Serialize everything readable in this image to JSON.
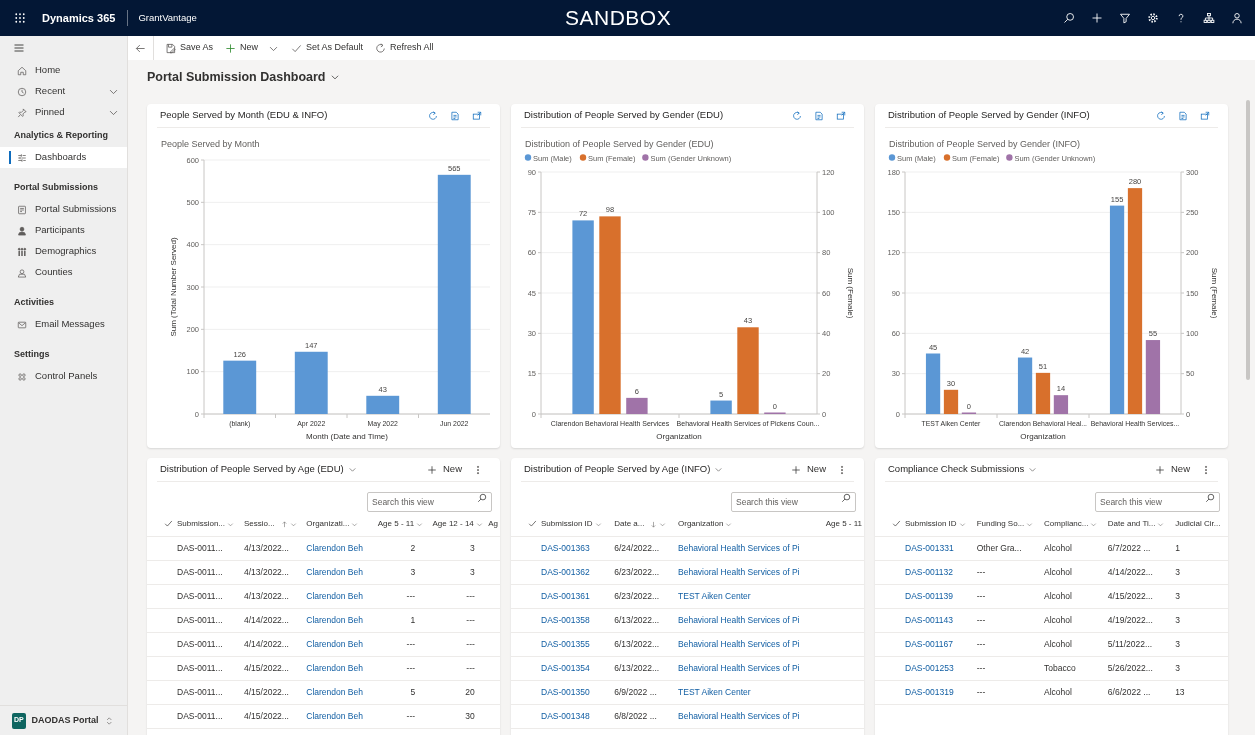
{
  "top_bar": {
    "app_name": "Dynamics 365",
    "app_module": "GrantVantage",
    "environment": "SANDBOX"
  },
  "command_bar": {
    "buttons": [
      {
        "label": "Save As",
        "dropdown": false
      },
      {
        "label": "New",
        "dropdown": true
      },
      {
        "label": "Set As Default",
        "dropdown": false
      },
      {
        "label": "Refresh All",
        "dropdown": false
      }
    ]
  },
  "sidebar": {
    "nav": [
      {
        "label": "Home",
        "expandable": false
      },
      {
        "label": "Recent",
        "expandable": true
      },
      {
        "label": "Pinned",
        "expandable": true
      }
    ],
    "groups": [
      {
        "title": "Analytics & Reporting",
        "items": [
          {
            "label": "Dashboards",
            "selected": true
          }
        ]
      },
      {
        "title": "Portal Submissions",
        "items": [
          {
            "label": "Portal Submissions",
            "selected": false
          },
          {
            "label": "Participants",
            "selected": false
          },
          {
            "label": "Demographics",
            "selected": false
          },
          {
            "label": "Counties",
            "selected": false
          }
        ]
      },
      {
        "title": "Activities",
        "items": [
          {
            "label": "Email Messages",
            "selected": false
          }
        ]
      },
      {
        "title": "Settings",
        "items": [
          {
            "label": "Control Panels",
            "selected": false
          }
        ]
      }
    ],
    "footer": {
      "badge": "DP",
      "label": "DAODAS Portal"
    }
  },
  "dashboard": {
    "title": "Portal Submission Dashboard",
    "charts": [
      {
        "title": "People Served by Month (EDU & INFO)",
        "chart_data": {
          "type": "bar",
          "title": "People Served by Month",
          "xlabel": "Month (Date and Time)",
          "ylabel": "Sum (Total Number Served)",
          "categories": [
            "(blank)",
            "Apr 2022",
            "May 2022",
            "Jun 2022"
          ],
          "values": [
            126,
            147,
            43,
            565
          ],
          "ylim": [
            0,
            600
          ],
          "yticks": [
            0,
            100,
            200,
            300,
            400,
            500,
            600
          ],
          "grid": true,
          "data_labels": true
        }
      },
      {
        "title": "Distribution of People Served by Gender (EDU)",
        "chart_data": {
          "type": "bar",
          "title": "Distribution of People Served by Gender (EDU)",
          "xlabel": "Organization",
          "y2label": "Sum (Female)",
          "categories": [
            "Clarendon Behavioral Health Services",
            "Behavioral Health Services of Pickens Coun..."
          ],
          "series": [
            {
              "name": "Sum (Male)",
              "color": "#5b97d5",
              "values": [
                72,
                5
              ]
            },
            {
              "name": "Sum (Female)",
              "color": "#d8702c",
              "axis": "y2",
              "values": [
                98,
                43
              ]
            },
            {
              "name": "Sum (Gender Unknown)",
              "color": "#a073a8",
              "values": [
                6,
                0
              ]
            }
          ],
          "legend": "top",
          "ylim": [
            0,
            90
          ],
          "yticks": [
            0,
            15,
            30,
            45,
            60,
            75,
            90
          ],
          "y2lim": [
            0,
            120
          ],
          "y2ticks": [
            0,
            20,
            40,
            60,
            80,
            100,
            120
          ],
          "grid": true,
          "data_labels": true
        }
      },
      {
        "title": "Distribution of People Served by Gender (INFO)",
        "chart_data": {
          "type": "bar",
          "title": "Distribution of People Served by Gender (INFO)",
          "xlabel": "Organization",
          "y2label": "Sum (Female)",
          "categories": [
            "TEST Aiken Center",
            "Clarendon Behavioral Heal...",
            "Behavioral Health Services..."
          ],
          "series": [
            {
              "name": "Sum (Male)",
              "color": "#5b97d5",
              "values": [
                45,
                42,
                155
              ]
            },
            {
              "name": "Sum (Female)",
              "color": "#d8702c",
              "axis": "y2",
              "values": [
                30,
                51,
                280
              ]
            },
            {
              "name": "Sum (Gender Unknown)",
              "color": "#a073a8",
              "values": [
                0,
                14,
                55
              ]
            }
          ],
          "legend": "top",
          "ylim": [
            0,
            180
          ],
          "yticks": [
            0,
            30,
            60,
            90,
            120,
            150,
            180
          ],
          "y2lim": [
            0,
            300
          ],
          "y2ticks": [
            0,
            50,
            100,
            150,
            200,
            250,
            300
          ],
          "grid": true,
          "data_labels": true
        }
      }
    ],
    "views": [
      {
        "title": "Distribution of People Served by Age (EDU)",
        "new_label": "New",
        "search_placeholder": "Search this view",
        "columns": [
          {
            "label": "Submission...",
            "kind": "text",
            "sorted": false,
            "menu": true
          },
          {
            "label": "Sessio...",
            "kind": "text",
            "sorted": true,
            "ascending": true,
            "menu": true
          },
          {
            "label": "Organizati...",
            "kind": "link",
            "sorted": false,
            "menu": true
          },
          {
            "label": "Age 5 - 11",
            "kind": "number",
            "sorted": false,
            "menu": true
          },
          {
            "label": "Age 12 - 14",
            "kind": "number",
            "sorted": false,
            "menu": true
          },
          {
            "label": "Ag",
            "kind": "number",
            "sorted": false,
            "menu": false
          }
        ],
        "rows": [
          [
            "DAS-0011...",
            "4/13/2022...",
            "Clarendon Beh",
            "2",
            "3"
          ],
          [
            "DAS-0011...",
            "4/13/2022...",
            "Clarendon Beh",
            "3",
            "3"
          ],
          [
            "DAS-0011...",
            "4/13/2022...",
            "Clarendon Beh",
            "---",
            "---"
          ],
          [
            "DAS-0011...",
            "4/14/2022...",
            "Clarendon Beh",
            "1",
            "---"
          ],
          [
            "DAS-0011...",
            "4/14/2022...",
            "Clarendon Beh",
            "---",
            "---"
          ],
          [
            "DAS-0011...",
            "4/15/2022...",
            "Clarendon Beh",
            "---",
            "---"
          ],
          [
            "DAS-0011...",
            "4/15/2022...",
            "Clarendon Beh",
            "5",
            "20"
          ],
          [
            "DAS-0011...",
            "4/15/2022...",
            "Clarendon Beh",
            "---",
            "30"
          ]
        ]
      },
      {
        "title": "Distribution of People Served by Age (INFO)",
        "new_label": "New",
        "search_placeholder": "Search this view",
        "columns": [
          {
            "label": "Submission ID",
            "kind": "link",
            "sorted": false,
            "menu": true
          },
          {
            "label": "Date a...",
            "kind": "text",
            "sorted": true,
            "ascending": false,
            "menu": true
          },
          {
            "label": "Organization",
            "kind": "link",
            "sorted": false,
            "menu": true
          },
          {
            "label": "Age 5 - 11",
            "kind": "number",
            "sorted": false,
            "menu": false
          }
        ],
        "rows": [
          [
            "DAS-001363",
            "6/24/2022...",
            "Behavioral Health Services of Pi"
          ],
          [
            "DAS-001362",
            "6/23/2022...",
            "Behavioral Health Services of Pi"
          ],
          [
            "DAS-001361",
            "6/23/2022...",
            "TEST Aiken Center"
          ],
          [
            "DAS-001358",
            "6/13/2022...",
            "Behavioral Health Services of Pi"
          ],
          [
            "DAS-001355",
            "6/13/2022...",
            "Behavioral Health Services of Pi"
          ],
          [
            "DAS-001354",
            "6/13/2022...",
            "Behavioral Health Services of Pi"
          ],
          [
            "DAS-001350",
            "6/9/2022 ...",
            "TEST Aiken Center"
          ],
          [
            "DAS-001348",
            "6/8/2022 ...",
            "Behavioral Health Services of Pi"
          ]
        ]
      },
      {
        "title": "Compliance Check Submissions",
        "new_label": "New",
        "search_placeholder": "Search this view",
        "columns": [
          {
            "label": "Submission ID",
            "kind": "link",
            "sorted": false,
            "menu": true
          },
          {
            "label": "Funding So...",
            "kind": "text",
            "sorted": false,
            "menu": true
          },
          {
            "label": "Complianc...",
            "kind": "text",
            "sorted": false,
            "menu": true
          },
          {
            "label": "Date and Ti...",
            "kind": "text",
            "sorted": false,
            "menu": true
          },
          {
            "label": "Judicial Cir...",
            "kind": "text",
            "sorted": false,
            "menu": false
          }
        ],
        "rows": [
          [
            "DAS-001331",
            "Other Gra...",
            "Alcohol",
            "6/7/2022 ...",
            "1"
          ],
          [
            "DAS-001132",
            "---",
            "Alcohol",
            "4/14/2022...",
            "3"
          ],
          [
            "DAS-001139",
            "---",
            "Alcohol",
            "4/15/2022...",
            "3"
          ],
          [
            "DAS-001143",
            "---",
            "Alcohol",
            "4/19/2022...",
            "3"
          ],
          [
            "DAS-001167",
            "---",
            "Alcohol",
            "5/11/2022...",
            "3"
          ],
          [
            "DAS-001253",
            "---",
            "Tobacco",
            "5/26/2022...",
            "3"
          ],
          [
            "DAS-001319",
            "---",
            "Alcohol",
            "6/6/2022 ...",
            "13"
          ]
        ]
      }
    ]
  }
}
